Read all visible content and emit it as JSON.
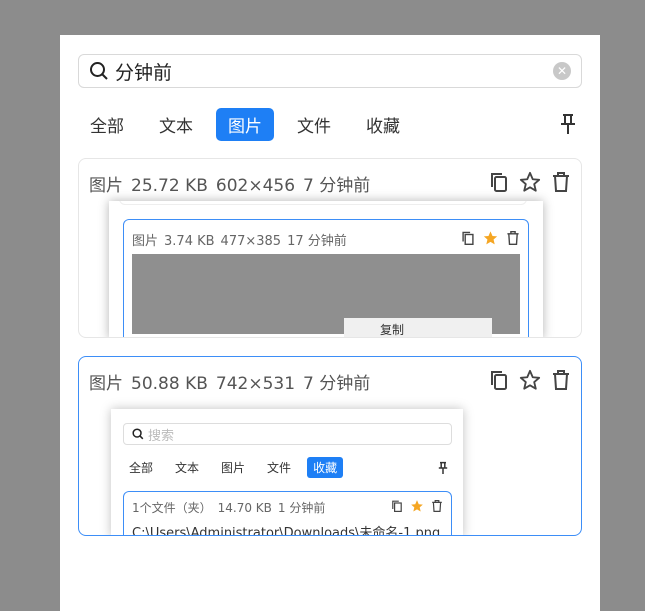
{
  "search": {
    "value": "分钟前"
  },
  "tabs": [
    {
      "label": "全部"
    },
    {
      "label": "文本"
    },
    {
      "label": "图片",
      "active": true
    },
    {
      "label": "文件"
    },
    {
      "label": "收藏"
    }
  ],
  "items": [
    {
      "type": "图片",
      "size": "25.72 KB",
      "dims": "602×456",
      "time": "7 分钟前",
      "starred": false,
      "preview": {
        "type": "图片",
        "size": "3.74 KB",
        "dims": "477×385",
        "time": "17 分钟前",
        "starred": true,
        "menu_text": "复制"
      }
    },
    {
      "type": "图片",
      "size": "50.88 KB",
      "dims": "742×531",
      "time": "7 分钟前",
      "starred": false,
      "preview": {
        "search_placeholder": "搜索",
        "tabs": [
          "全部",
          "文本",
          "图片",
          "文件",
          "收藏"
        ],
        "active_tab": "收藏",
        "item": {
          "type": "1个文件（夹）",
          "size": "14.70 KB",
          "time": "1 分钟前",
          "starred": true,
          "path": "C:\\Users\\Administrator\\Downloads\\未命名-1.png"
        }
      }
    }
  ],
  "colors": {
    "accent": "#1e7ff5",
    "star": "#f5a623"
  }
}
